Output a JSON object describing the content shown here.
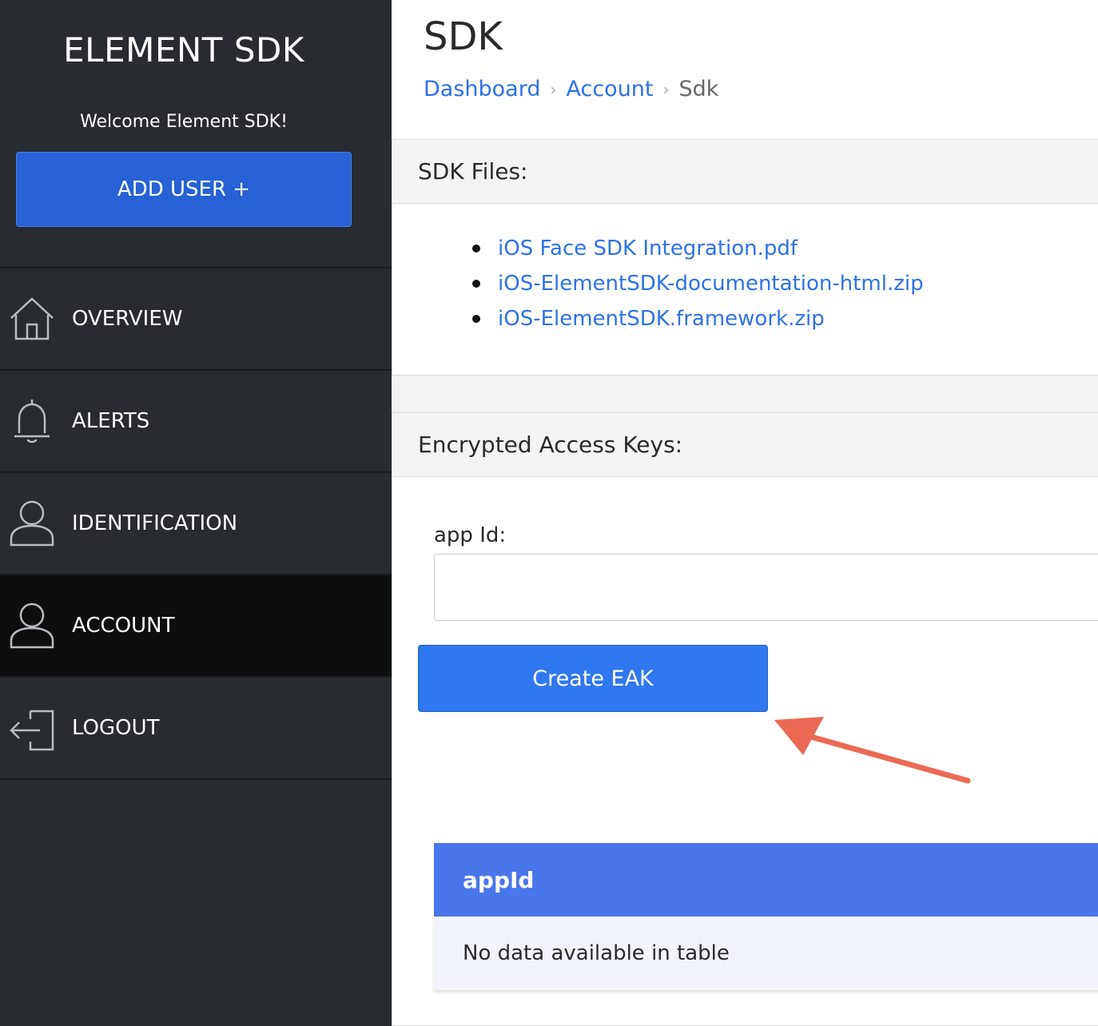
{
  "sidebar": {
    "brand": "ELEMENT SDK",
    "welcome": "Welcome Element SDK!",
    "add_user_label": "ADD USER +",
    "nav": [
      {
        "label": "OVERVIEW",
        "icon": "home-icon"
      },
      {
        "label": "ALERTS",
        "icon": "bell-icon"
      },
      {
        "label": "IDENTIFICATION",
        "icon": "user-icon"
      },
      {
        "label": "ACCOUNT",
        "icon": "user-icon",
        "active": true
      },
      {
        "label": "LOGOUT",
        "icon": "logout-icon"
      }
    ]
  },
  "header": {
    "title": "SDK",
    "breadcrumb": [
      "Dashboard",
      "Account",
      "Sdk"
    ]
  },
  "files_card": {
    "title": "SDK Files:",
    "files": [
      "iOS Face SDK Integration.pdf",
      "iOS-ElementSDK-documentation-html.zip",
      "iOS-ElementSDK.framework.zip"
    ]
  },
  "keys_card": {
    "title": "Encrypted Access Keys:",
    "app_id_label": "app Id:",
    "app_id_value": "",
    "create_button": "Create EAK",
    "table": {
      "columns": [
        "appId"
      ],
      "empty_message": "No data available in table"
    }
  },
  "colors": {
    "sidebar_bg": "#282b30",
    "active_nav_bg": "#0d0f0f",
    "primary_button": "#2f78ef",
    "link": "#2d72e6",
    "table_header": "#4a76eb",
    "annotation_arrow": "#ec6a55"
  }
}
